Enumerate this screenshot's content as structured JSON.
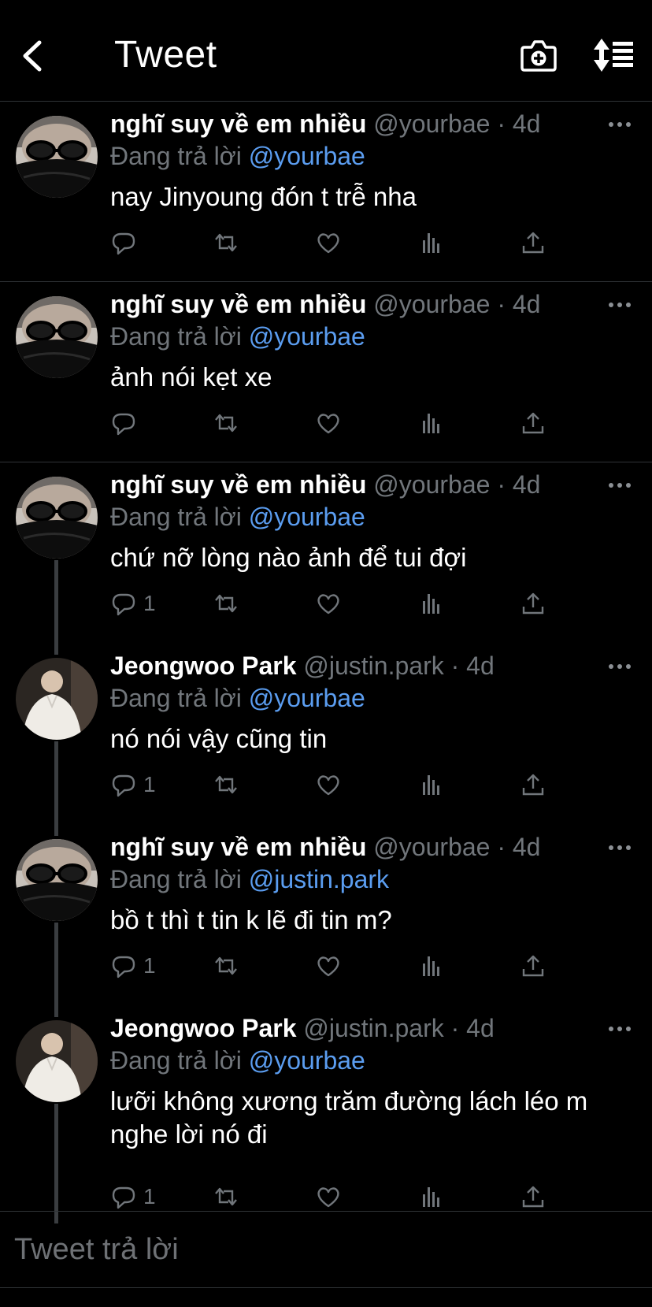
{
  "header": {
    "title": "Tweet"
  },
  "tweets": [
    {
      "name": "nghĩ suy về em nhiều",
      "meta": "@yourbae · 4d",
      "reply_prefix": "Đang trả lời",
      "reply_to": "@yourbae",
      "text": "nay Jinyoung đón t trễ nha",
      "reply_count": "",
      "avatar": "dark"
    },
    {
      "name": "nghĩ suy về em nhiều",
      "meta": "@yourbae · 4d",
      "reply_prefix": "Đang trả lời",
      "reply_to": "@yourbae",
      "text": "ảnh nói kẹt xe",
      "reply_count": "",
      "avatar": "dark"
    },
    {
      "name": "nghĩ suy về em nhiều",
      "meta": "@yourbae · 4d",
      "reply_prefix": "Đang trả lời",
      "reply_to": "@yourbae",
      "text": "chứ nỡ lòng nào ảnh để tui đợi",
      "reply_count": "1",
      "avatar": "dark"
    },
    {
      "name": "Jeongwoo Park",
      "meta": "@justin.park · 4d",
      "reply_prefix": "Đang trả lời",
      "reply_to": "@yourbae",
      "text": "nó nói vậy cũng tin",
      "reply_count": "1",
      "avatar": "light"
    },
    {
      "name": "nghĩ suy về em nhiều",
      "meta": "@yourbae · 4d",
      "reply_prefix": "Đang trả lời",
      "reply_to": "@justin.park",
      "text": "bồ t thì t tin k lẽ đi tin m?",
      "reply_count": "1",
      "avatar": "dark"
    },
    {
      "name": "Jeongwoo Park",
      "meta": "@justin.park · 4d",
      "reply_prefix": "Đang trả lời",
      "reply_to": "@yourbae",
      "text": "lưỡi không xương trăm đường lách léo m nghe lời nó đi",
      "reply_count": "1",
      "avatar": "light"
    }
  ],
  "compose": {
    "placeholder": "Tweet trả lời"
  },
  "colors": {
    "background": "#000000",
    "handle": "#71767b",
    "mention": "#5b9df0",
    "divider": "#2f3336"
  }
}
